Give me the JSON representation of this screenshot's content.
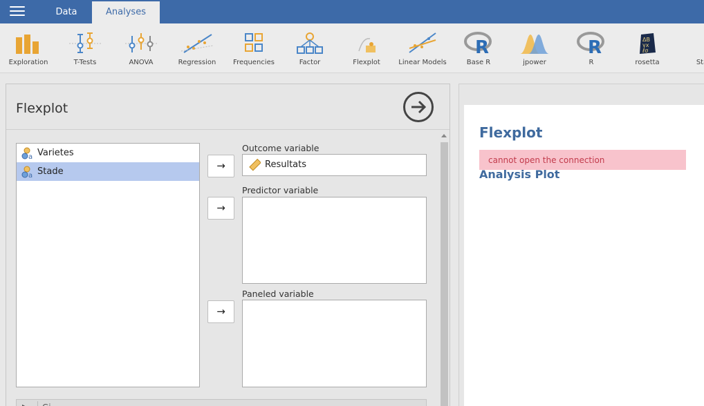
{
  "topbar": {
    "tabs": [
      {
        "label": "Data"
      },
      {
        "label": "Analyses",
        "active": true
      }
    ]
  },
  "ribbon": {
    "items": [
      {
        "label": "Exploration",
        "icon": "exploration-icon"
      },
      {
        "label": "T-Tests",
        "icon": "t-tests-icon"
      },
      {
        "label": "ANOVA",
        "icon": "anova-icon"
      },
      {
        "label": "Regression",
        "icon": "regression-icon"
      },
      {
        "label": "Frequencies",
        "icon": "frequencies-icon"
      },
      {
        "label": "Factor",
        "icon": "factor-icon"
      },
      {
        "label": "Flexplot",
        "icon": "flexplot-icon"
      },
      {
        "label": "Linear Models",
        "icon": "linear-models-icon"
      },
      {
        "label": "Base R",
        "icon": "r-logo-icon"
      },
      {
        "label": "jpower",
        "icon": "jpower-icon"
      },
      {
        "label": "R",
        "icon": "r-logo-icon"
      },
      {
        "label": "rosetta",
        "icon": "rosetta-icon"
      },
      {
        "label": "Stat",
        "icon": "stat-icon"
      }
    ]
  },
  "analysis": {
    "title": "Flexplot",
    "variables": [
      {
        "name": "Varietes",
        "type": "nominal",
        "selected": false
      },
      {
        "name": "Stade",
        "type": "nominal",
        "selected": true
      }
    ],
    "outcome": {
      "label": "Outcome variable",
      "value": "Resultats"
    },
    "predictor": {
      "label": "Predictor variable"
    },
    "paneled": {
      "label": "Paneled variable"
    },
    "collapsed_section_label": "Gi",
    "arrow_glyph": "→"
  },
  "results": {
    "title": "Flexplot",
    "error": "cannot open the connection",
    "subtitle": "Analysis Plot"
  },
  "colors": {
    "accent": "#3d6aa8",
    "selection": "#b6c9ee",
    "error_bg": "#f8c3cc",
    "error_text": "#c23b4c",
    "heading": "#3f6a9e",
    "icon_orange": "#e8a534",
    "icon_blue": "#4a86c8"
  }
}
